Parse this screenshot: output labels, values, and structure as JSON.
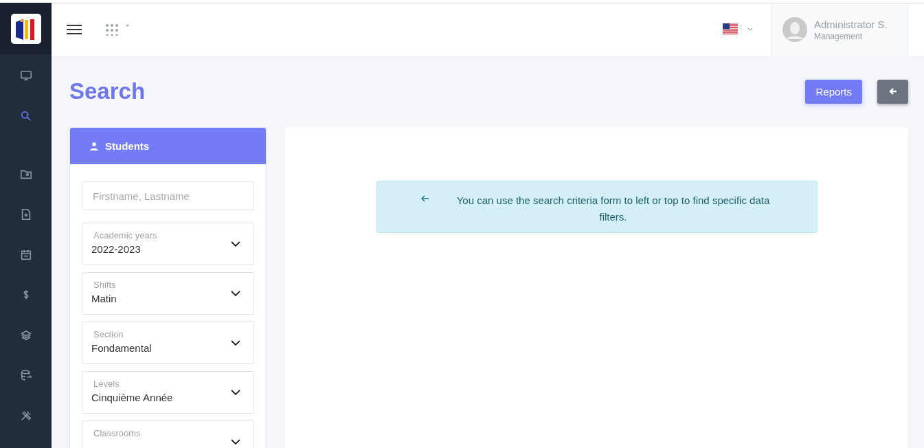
{
  "sidebar": {
    "items": [
      {
        "selected": false
      },
      {
        "selected": true
      },
      {
        "selected": false
      },
      {
        "selected": false
      },
      {
        "selected": false
      },
      {
        "selected": false
      },
      {
        "selected": false
      },
      {
        "selected": false
      },
      {
        "selected": false
      }
    ]
  },
  "user": {
    "name": "Administrator S.",
    "role": "Management"
  },
  "page": {
    "title": "Search",
    "buttons": [
      "Reports"
    ]
  },
  "students_panel": {
    "title": "Students",
    "search": {
      "placeholder": "Firstname, Lastname"
    },
    "selects": [
      {
        "label": "Academic years",
        "value": "2022-2023"
      },
      {
        "label": "Shifts",
        "value": "Matin"
      },
      {
        "label": "Section",
        "value": "Fondamental"
      },
      {
        "label": "Levels",
        "value": "Cinquième Année"
      },
      {
        "label": "Classrooms"
      }
    ]
  },
  "alert": {
    "text": "You can use the search criteria form to left or top to find specific data filters."
  }
}
